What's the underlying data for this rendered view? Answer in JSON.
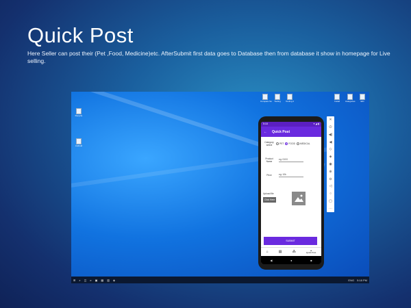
{
  "slide": {
    "title": "Quick Post",
    "description": "Here Seller can post their (Pet ,Food, Medicine)etc. AfterSubmit first data goes to Database then from database it show in homepage for Live selling."
  },
  "desktop": {
    "left_icons": [
      {
        "label": "Recycle",
        "icon": "recycle-bin-icon"
      },
      {
        "label": "Android",
        "icon": "file-icon"
      }
    ],
    "top_icons": [
      {
        "label": "Compare Su",
        "icon": "document-icon"
      },
      {
        "label": "Tooling",
        "icon": "document-icon"
      },
      {
        "label": "Tooling 2",
        "icon": "document-icon"
      },
      {
        "label": "Install",
        "icon": "document-icon"
      },
      {
        "label": "Categories",
        "icon": "document-icon"
      },
      {
        "label": "EID",
        "icon": "document-icon"
      }
    ]
  },
  "phone": {
    "status": {
      "time": "5:18",
      "icons": "▾ ◢ ▮"
    },
    "app_title": "Quick Post",
    "back_glyph": "←",
    "category_label": "Category select",
    "categories": [
      "PET",
      "FOOD",
      "MEDICAL"
    ],
    "selected_category": "FOOD",
    "product_name_label": "Product Name",
    "product_name_placeholder": "eg: DOG",
    "price_label": "Price",
    "price_placeholder": "eg: 10k",
    "upload_label": "Upload file",
    "choose_button": "Click Here",
    "submit_button": "SUBMIT",
    "bottom_nav": [
      {
        "icon": "home-icon",
        "glyph": "⌂"
      },
      {
        "icon": "store-icon",
        "glyph": "▤"
      },
      {
        "icon": "grid-icon",
        "glyph": "⁂"
      }
    ],
    "bottom_nav_last": "Quick Post",
    "system_nav": [
      "◀",
      "●",
      "■"
    ]
  },
  "emulator_toolbar": [
    "✕",
    "⏻",
    "◀)",
    "◀",
    "◇",
    "◈",
    "◉",
    "⊕",
    "⊖",
    "◁",
    "○",
    "▢",
    "⋯"
  ],
  "taskbar": {
    "items": [
      "⊞",
      "⌕",
      "◫",
      "e",
      "▣",
      "▦",
      "▥",
      "◈"
    ],
    "tray": [
      "ENG",
      "5:18 PM"
    ]
  },
  "colors": {
    "accent": "#6a2adf",
    "status_bar": "#5b1fc2"
  }
}
